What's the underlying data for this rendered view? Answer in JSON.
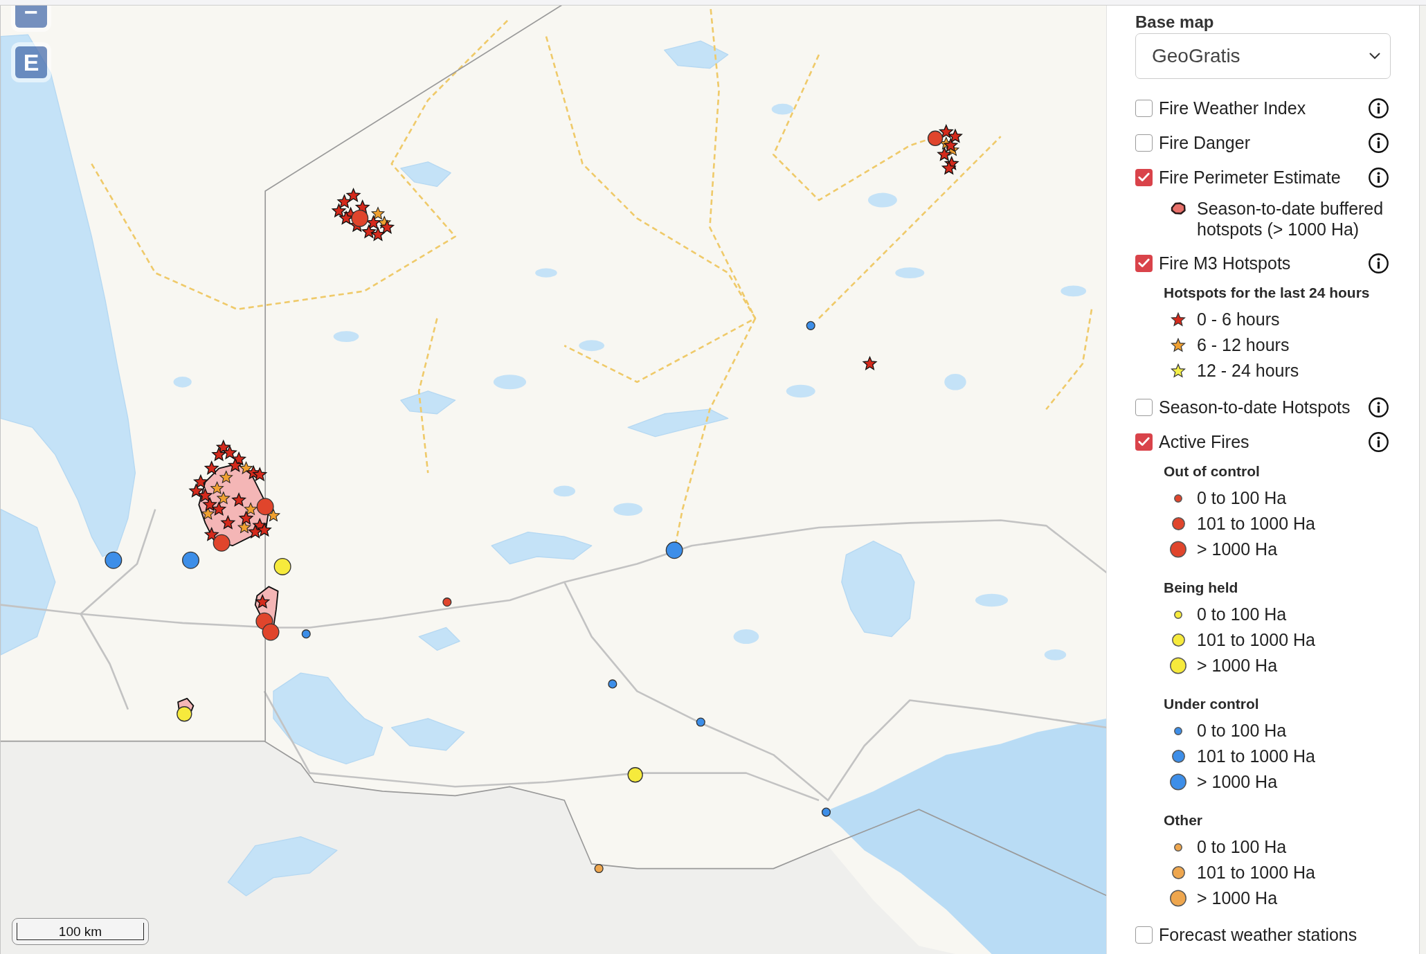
{
  "map": {
    "controls": [
      "−",
      "E"
    ],
    "scale_bar": "100 km"
  },
  "legend": {
    "title": "Base map",
    "base_map": "GeoGratis",
    "layers": [
      {
        "label": "Fire Weather Index",
        "checked": false,
        "info": true
      },
      {
        "label": "Fire Danger",
        "checked": false,
        "info": true
      },
      {
        "label": "Fire Perimeter Estimate",
        "checked": true,
        "info": true,
        "items": [
          {
            "kind": "perimeter",
            "color": "#e8706a",
            "label": "Season-to-date buffered hotspots (> 1000 Ha)"
          }
        ]
      },
      {
        "label": "Fire M3 Hotspots",
        "checked": true,
        "info": true,
        "groups": [
          {
            "title": "Hotspots for the last 24 hours",
            "items": [
              {
                "kind": "star",
                "color": "#d42a1c",
                "label": "0 - 6 hours"
              },
              {
                "kind": "star",
                "color": "#f0a030",
                "label": "6 - 12 hours"
              },
              {
                "kind": "star",
                "color": "#f4f04a",
                "label": "12 - 24 hours"
              }
            ]
          }
        ]
      },
      {
        "label": "Season-to-date Hotspots",
        "checked": false,
        "info": true
      },
      {
        "label": "Active Fires",
        "checked": true,
        "info": true,
        "groups": [
          {
            "title": "Out of control",
            "items": [
              {
                "kind": "small_circle",
                "color": "#e0452c",
                "label": "0 to 100 Ha"
              },
              {
                "kind": "medium_circle",
                "color": "#e0452c",
                "label": "101 to 1000 Ha"
              },
              {
                "kind": "large_circle",
                "color": "#e0452c",
                "label": "> 1000 Ha"
              }
            ]
          },
          {
            "title": "Being held",
            "items": [
              {
                "kind": "small_circle",
                "color": "#f6ea3c",
                "label": "0 to 100 Ha"
              },
              {
                "kind": "medium_circle",
                "color": "#f6ea3c",
                "label": "101 to 1000 Ha"
              },
              {
                "kind": "large_circle",
                "color": "#f6ea3c",
                "label": "> 1000 Ha"
              }
            ]
          },
          {
            "title": "Under control",
            "items": [
              {
                "kind": "small_circle",
                "color": "#3d8ee8",
                "label": "0 to 100 Ha"
              },
              {
                "kind": "medium_circle",
                "color": "#3d8ee8",
                "label": "101 to 1000 Ha"
              },
              {
                "kind": "large_circle",
                "color": "#3d8ee8",
                "label": "> 1000 Ha"
              }
            ]
          },
          {
            "title": "Other",
            "items": [
              {
                "kind": "small_circle",
                "color": "#eea64e",
                "label": "0 to 100 Ha"
              },
              {
                "kind": "medium_circle",
                "color": "#eea64e",
                "label": "101 to 1000 Ha"
              },
              {
                "kind": "large_circle",
                "color": "#eea64e",
                "label": "> 1000 Ha"
              }
            ]
          }
        ]
      },
      {
        "label": "Forecast weather stations",
        "checked": false,
        "info": false
      }
    ]
  }
}
